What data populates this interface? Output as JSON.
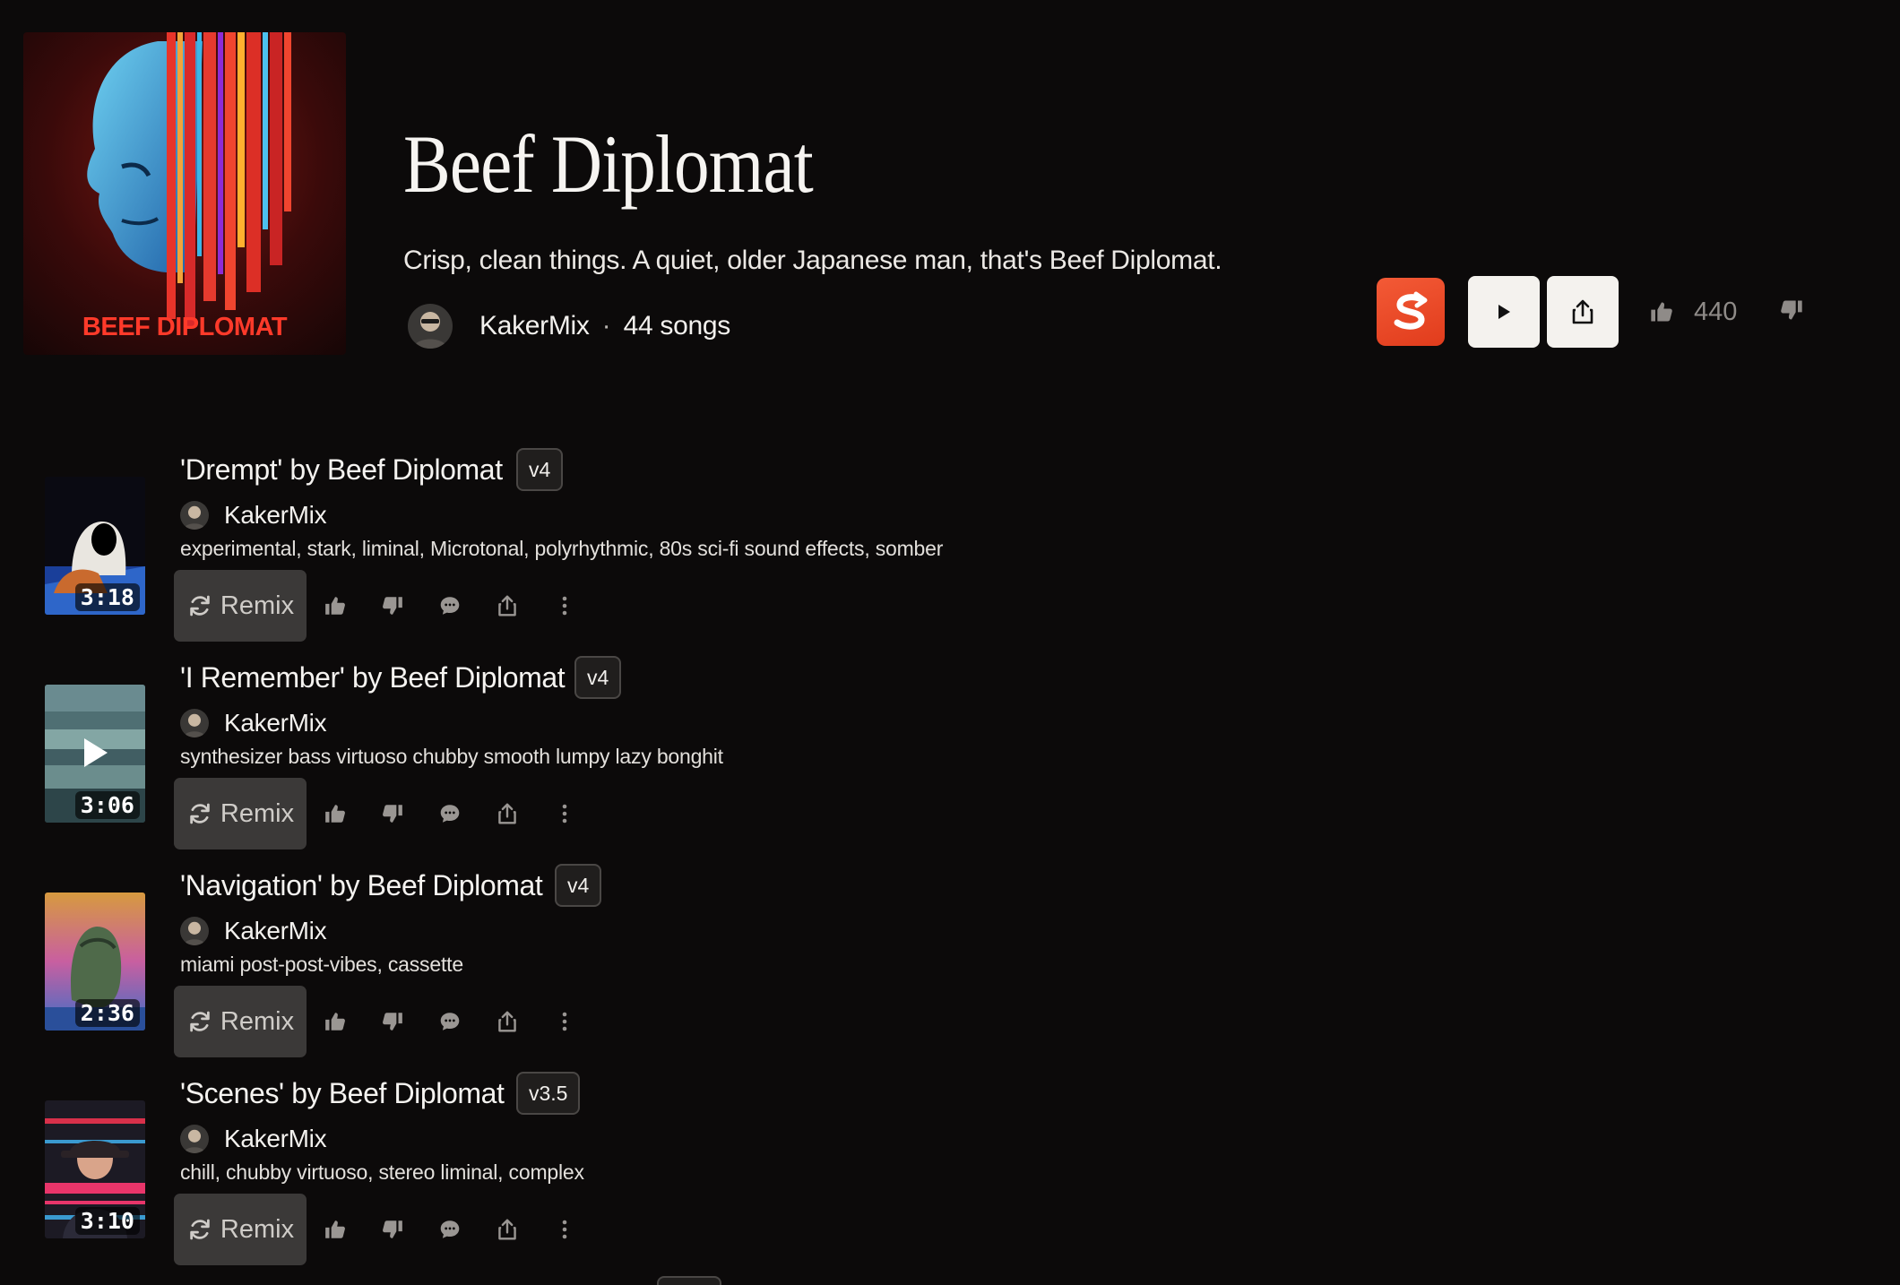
{
  "playlist": {
    "title": "Beef Diplomat",
    "description": "Crisp, clean things. A quiet, older Japanese man, that's Beef Diplomat.",
    "cover_caption": "BEEF DIPLOMAT",
    "owner": "KakerMix",
    "separator": "·",
    "song_count": "44 songs",
    "likes": "440"
  },
  "actions": {
    "brand_icon": "s-swap-icon",
    "play_icon": "play-icon",
    "share_icon": "share-icon",
    "remix_label": "Remix"
  },
  "colors": {
    "background": "#0c0a0a",
    "brand": "#e8482a",
    "remix": "#3b3938"
  },
  "songs": [
    {
      "title": "'Drempt' by Beef Diplomat",
      "version": "v4",
      "artist": "KakerMix",
      "tags": "experimental, stark, liminal, Microtonal, polyrhythmic, 80s sci-fi sound effects, somber",
      "duration": "3:18"
    },
    {
      "title": "'I Remember' by Beef Diplomat",
      "version": "v4",
      "artist": "KakerMix",
      "tags": "synthesizer bass virtuoso chubby smooth lumpy lazy bonghit",
      "duration": "3:06"
    },
    {
      "title": "'Navigation' by Beef Diplomat",
      "version": "v4",
      "artist": "KakerMix",
      "tags": "miami post-post-vibes, cassette",
      "duration": "2:36"
    },
    {
      "title": "'Scenes' by Beef Diplomat",
      "version": "v3.5",
      "artist": "KakerMix",
      "tags": "chill, chubby virtuoso, stereo liminal, complex",
      "duration": "3:10"
    }
  ]
}
